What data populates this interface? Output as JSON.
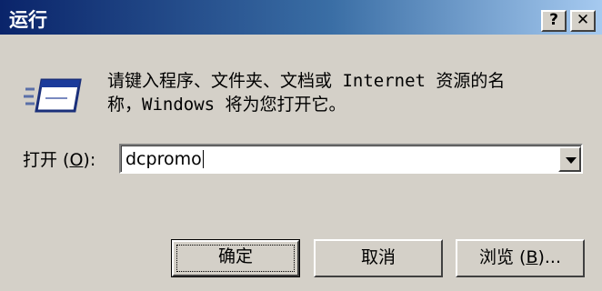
{
  "window": {
    "title": "运行",
    "help_glyph": "?",
    "close_glyph": "✕"
  },
  "content": {
    "desc_line1": "请键入程序、文件夹、文档或 Internet 资源的名",
    "desc_line2": "称，Windows 将为您打开它。",
    "open_label_prefix": "打开 (",
    "open_label_accel": "O",
    "open_label_suffix": "):",
    "command_value": "dcpromo"
  },
  "buttons": {
    "ok": "确定",
    "cancel": "取消",
    "browse_prefix": "浏览 (",
    "browse_accel": "B",
    "browse_suffix": ")..."
  },
  "colors": {
    "title_start": "#0a246a",
    "title_end": "#a6caf0",
    "face": "#d4d0c8"
  },
  "icons": {
    "run": "run-window-icon",
    "dropdown": "chevron-down-icon"
  }
}
